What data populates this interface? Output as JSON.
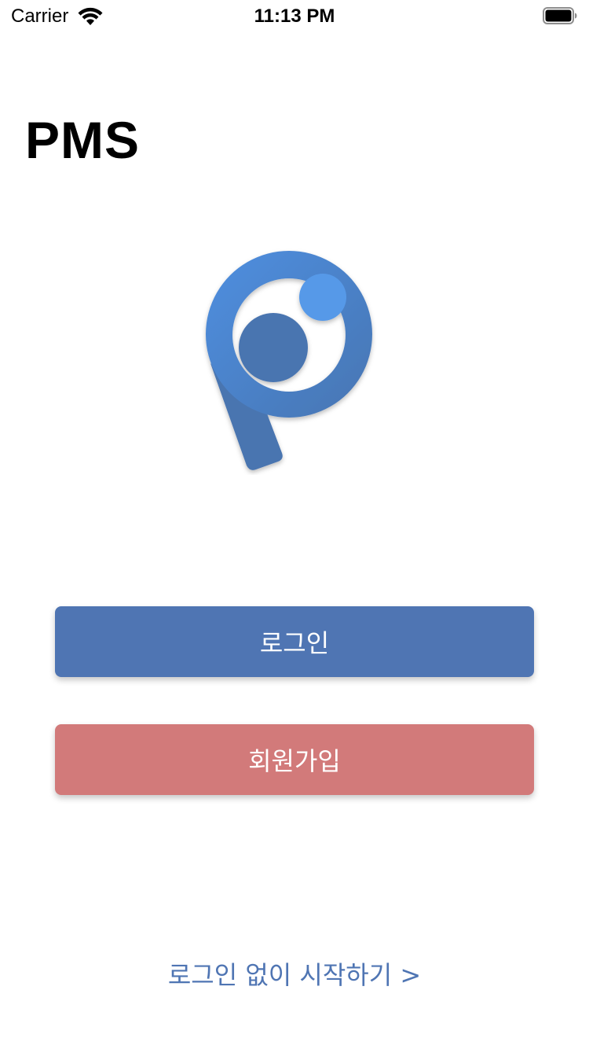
{
  "status_bar": {
    "carrier": "Carrier",
    "time": "11:13 PM",
    "wifi_icon": "wifi-icon",
    "battery_icon": "battery-icon"
  },
  "app": {
    "title": "PMS",
    "logo_icon": "pms-logo"
  },
  "buttons": {
    "login_label": "로그인",
    "signup_label": "회원가입"
  },
  "guest_link": "로그인 없이 시작하기 >",
  "colors": {
    "primary": "#4f75b3",
    "secondary": "#d27a7a",
    "logo_dark": "#4a74b0",
    "logo_light": "#5699e8"
  }
}
